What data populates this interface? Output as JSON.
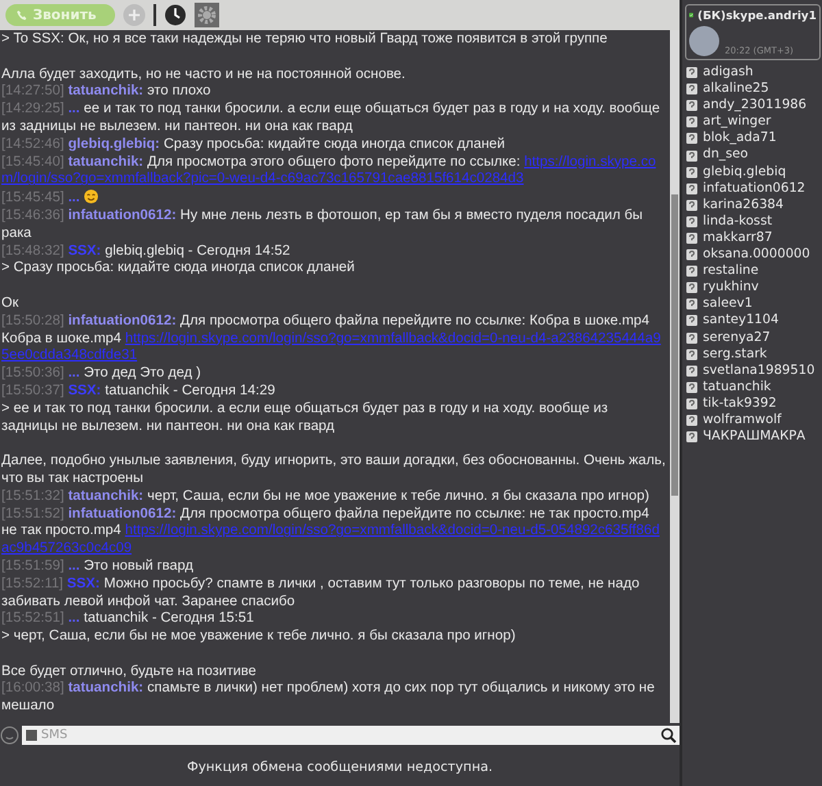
{
  "toolbar": {
    "call_button": "Звонить"
  },
  "messages": [
    {
      "kind": "plain",
      "text": "> To SSX: Ок, но я все таки надежды не теряю что новый Гвард тоже появится в этой группе"
    },
    {
      "kind": "plain",
      "gap_before": true,
      "text": "Алла будет заходить, но не часто и не на постоянной основе."
    },
    {
      "kind": "message",
      "time": "[14:27:50]",
      "nick": "tatuanchik:",
      "color": "#8f8bf0",
      "text": "это плохо"
    },
    {
      "kind": "message",
      "time": "[14:29:25]",
      "nick": "...",
      "color": "#5a5aff",
      "text": "ее и так то под танки бросили. а если еще общаться будет раз в году и на ходу. вообще из задницы не вылезем. ни пантеон. ни она как гвард"
    },
    {
      "kind": "message",
      "time": "[14:52:46]",
      "nick": "glebiq.glebiq:",
      "color": "#8f8bf0",
      "text": "Сразу просьба: кидайте сюда иногда список дланей"
    },
    {
      "kind": "message",
      "time": "[15:45:40]",
      "nick": "tatuanchik:",
      "color": "#8f8bf0",
      "text": "Для просмотра этого общего фото перейдите по ссылке:",
      "link": "https://login.skype.com/login/sso?go=xmmfallback?pic=0-weu-d4-c69ac73c165791cae8815f614c0284d3"
    },
    {
      "kind": "message",
      "time": "[15:45:45]",
      "nick": "...",
      "color": "#5a5aff",
      "emoji": true
    },
    {
      "kind": "message",
      "time": "[15:46:36]",
      "nick": "infatuation0612:",
      "color": "#8f8bf0",
      "text": "Ну мне лень лезть в фотошоп, ер там бы я вместо пуделя посадил бы рака"
    },
    {
      "kind": "message",
      "time": "[15:48:32]",
      "nick": "SSX:",
      "color": "#3c3cff",
      "text": "glebiq.glebiq - Сегодня 14:52"
    },
    {
      "kind": "plain",
      "text": "> Сразу просьба: кидайте сюда иногда список дланей"
    },
    {
      "kind": "plain",
      "gap_before": true,
      "text": "Ок"
    },
    {
      "kind": "message",
      "time": "[15:50:28]",
      "nick": "infatuation0612:",
      "color": "#8f8bf0",
      "text": "Для просмотра общего файла перейдите по ссылке: Кобра в шоке.mp4 Кобра в шоке.mp4",
      "link": "https://login.skype.com/login/sso?go=xmmfallback&docid=0-neu-d4-a23864235444a95ee0cdda348cdfde31"
    },
    {
      "kind": "message",
      "time": "[15:50:36]",
      "nick": "...",
      "color": "#5a5aff",
      "text": "Это дед Это дед )"
    },
    {
      "kind": "message",
      "time": "[15:50:37]",
      "nick": "SSX:",
      "color": "#3c3cff",
      "text": "tatuanchik - Сегодня 14:29"
    },
    {
      "kind": "plain",
      "text": "> ее и так то под танки бросили. а если еще общаться будет раз в году и на ходу. вообще из задницы не вылезем. ни пантеон. ни она как гвард"
    },
    {
      "kind": "plain",
      "gap_before": true,
      "text": "Далее, подобно унылые заявления, буду игнорить, это ваши догадки, без обоснованны. Очень жаль, что вы так настроены"
    },
    {
      "kind": "message",
      "time": "[15:51:32]",
      "nick": "tatuanchik:",
      "color": "#8f8bf0",
      "text": "черт, Саша, если бы не мое уважение к тебе лично. я бы сказала про игнор)"
    },
    {
      "kind": "message",
      "time": "[15:51:52]",
      "nick": "infatuation0612:",
      "color": "#8f8bf0",
      "text": "Для просмотра общего файла перейдите по ссылке: не так просто.mp4 не так просто.mp4",
      "link": "https://login.skype.com/login/sso?go=xmmfallback&docid=0-neu-d5-054892c635ff86dac9b457263c0c4c09"
    },
    {
      "kind": "message",
      "time": "[15:51:59]",
      "nick": "...",
      "color": "#5a5aff",
      "text": "Это новый гвард"
    },
    {
      "kind": "message",
      "time": "[15:52:11]",
      "nick": "SSX:",
      "color": "#3c3cff",
      "text": "Можно просьбу? спамте в лички , оставим тут только разговоры по теме,  не надо забивать левой инфой чат. Заранее спасибо"
    },
    {
      "kind": "message",
      "time": "[15:52:51]",
      "nick": "...",
      "color": "#5a5aff",
      "text": "tatuanchik - Сегодня 15:51"
    },
    {
      "kind": "plain",
      "text": "> черт, Саша, если бы не мое уважение к тебе лично. я бы сказала про игнор)"
    },
    {
      "kind": "plain",
      "gap_before": true,
      "text": "Все будет отлично, будьте на позитиве"
    },
    {
      "kind": "message",
      "time": "[16:00:38]",
      "nick": "tatuanchik:",
      "color": "#8f8bf0",
      "text": "спамьте в лички) нет проблем) хотя до сих пор тут общались и никому это не мешало"
    }
  ],
  "input": {
    "placeholder": "SMS"
  },
  "status": "Функция обмена сообщениями недоступна.",
  "profile": {
    "name": "(БК)skype.andriy1",
    "time": "20:22 (GMT+3)"
  },
  "contacts": [
    "adigash",
    "alkaline25",
    "andy_23011986",
    "art_winger",
    "blok_ada71",
    "dn_seo",
    "glebiq.glebiq",
    "infatuation0612",
    "karina26384",
    "linda-kosst",
    "makkarr87",
    "oksana.0000000",
    "restaline",
    "ryukhinv",
    "saleev1",
    "santey1104",
    "serenya27",
    "serg.stark",
    "svetlana1989510",
    "tatuanchik",
    "tik-tak9392",
    "wolframwolf",
    "ЧАКРАШМАКРА"
  ]
}
